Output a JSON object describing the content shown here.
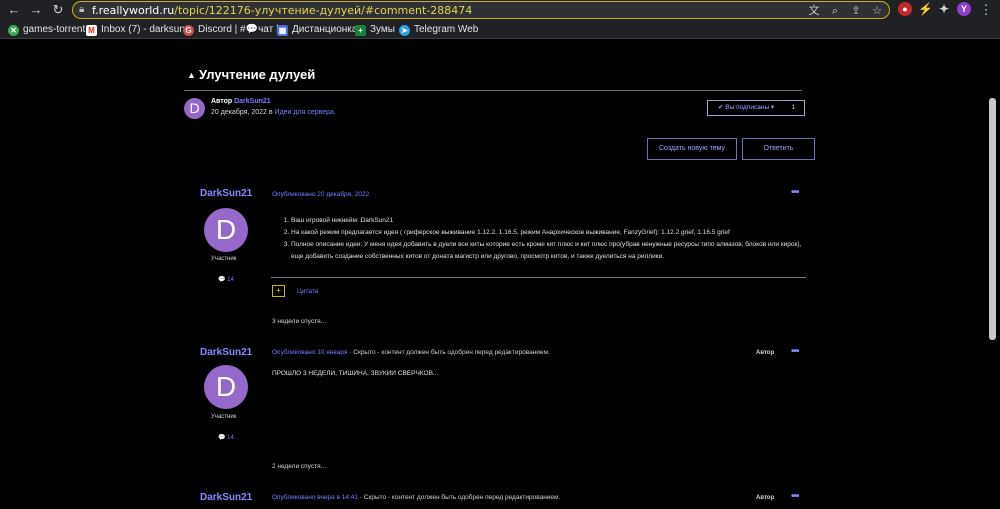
{
  "browser": {
    "url_host": "f.reallyworld.ru",
    "url_path": "/topic/122176-улучтение-дулуей/#comment-288474",
    "profile_initial": "Y",
    "bookmarks": [
      {
        "label": "games-torrent",
        "icon": "games-torrent-icon",
        "color": "#3aa757"
      },
      {
        "label": "Inbox (7) - darksun...",
        "icon": "gmail-icon",
        "color": "#d93025"
      },
      {
        "label": "Discord | #💬чат |...",
        "icon": "discord-icon",
        "color": "#5865f2"
      },
      {
        "label": "Дистанционка",
        "icon": "remote-learning-icon",
        "color": "#4a6ad9"
      },
      {
        "label": "Зумы",
        "icon": "sheets-icon",
        "color": "#188038"
      },
      {
        "label": "Telegram Web",
        "icon": "telegram-icon",
        "color": "#2aa3df"
      }
    ]
  },
  "topic": {
    "title": "Улучтение дулуей",
    "author_prefix": "Автор",
    "author": "DarkSun21",
    "avatar_letter": "D",
    "date": "20 декабря, 2022",
    "in_word": "в",
    "forum": "Идеи для сервера.",
    "follow_label": "✔ Вы подписаны ▾",
    "follow_count": "1",
    "new_topic_button": "Создать новую тему",
    "reply_button": "Ответить"
  },
  "posts": [
    {
      "author": "DarkSun21",
      "avatar_letter": "D",
      "role": "Участник",
      "count": "💬 14",
      "published": "Опубликовано 20 декабря, 2022",
      "items": [
        "Ваш игровой никнейм: DarkSun21",
        "На какой режим предлагается идея ( гриферское выживание 1.12.2, 1.16.5, режим Анархическое выживание, FanzyGrief): 1.12.2 grief, 1.16.5 grief",
        "Полное описание идеи: У меня идея добавить в дуели все киты которие есть кроме кит плюс и кит плюс про(убрав ненужные ресурсы типо алмазов, блоков или кирок), еще добавить создание собственных китов от доната магистр или другово, просмотр китов, и также дуелиться на риллики."
      ],
      "quote_label": "Цитата"
    },
    {
      "author": "DarkSun21",
      "avatar_letter": "D",
      "role": "Участник",
      "count": "💬 14",
      "published": "Опубликовано 10 января",
      "hidden_note": " · Скрыто - контент должен быть одобрен перед редактированием.",
      "author_tag": "Автор",
      "text": "ПРОШЛО 3 НЕДЕЛИ, ТИШИНА, ЗВУКИИ СВЕРЧКОВ..."
    },
    {
      "author": "DarkSun21",
      "published": "Опубликовано вчера в 14:41",
      "hidden_note": " · Скрыто - контент должен быть одобрен перед редактированием.",
      "author_tag": "Автор"
    }
  ],
  "timeline": {
    "first": "3 недели спустя...",
    "second": "2 недели спустя..."
  }
}
